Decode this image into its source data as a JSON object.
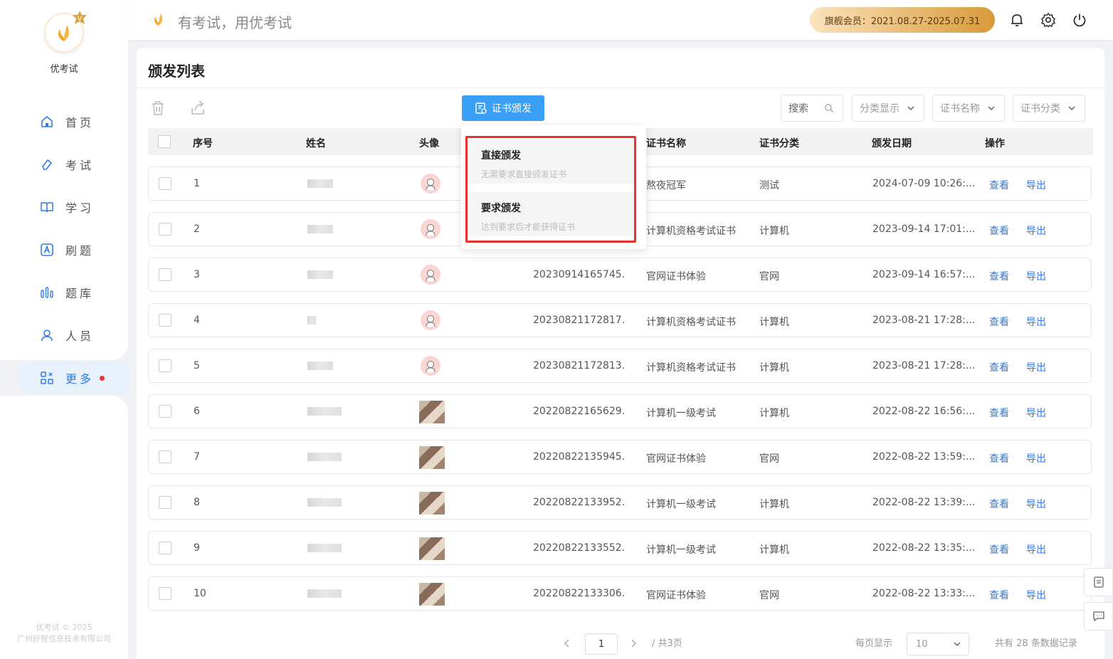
{
  "sidebar": {
    "brand": "优考试",
    "items": [
      {
        "label": "首页",
        "icon": "home-icon"
      },
      {
        "label": "考试",
        "icon": "eraser-icon"
      },
      {
        "label": "学习",
        "icon": "book-icon"
      },
      {
        "label": "刷题",
        "icon": "letter-a-icon"
      },
      {
        "label": "题库",
        "icon": "bars-icon"
      },
      {
        "label": "人员",
        "icon": "user-icon"
      },
      {
        "label": "更多",
        "icon": "apps-icon"
      }
    ],
    "copyright_1": "优考试 © 2025",
    "copyright_2": "广州好智信息技术有限公司"
  },
  "header": {
    "slogan": "有考试，用优考试",
    "vip": "旗舰会员：2021.08.27-2025.07.31"
  },
  "page": {
    "title": "颁发列表",
    "issue_button": "证书颁发",
    "search": "搜索",
    "filter_category": "分类显示",
    "filter_cert_name": "证书名称",
    "filter_cert_type": "证书分类"
  },
  "columns": {
    "index": "序号",
    "name": "姓名",
    "avatar": "头像",
    "cert_name": "证书名称",
    "cert_type": "证书分类",
    "date": "颁发日期",
    "ops": "操作"
  },
  "rows": [
    {
      "no": "1",
      "code": "",
      "cert": "熬夜冠军",
      "type": "测试",
      "date": "2024-07-09 10:26:...",
      "avatar": "default"
    },
    {
      "no": "2",
      "code": "",
      "cert": "计算机资格考试证书",
      "type": "计算机",
      "date": "2023-09-14 17:01:...",
      "avatar": "default"
    },
    {
      "no": "3",
      "code": "20230914165745...",
      "cert": "官网证书体验",
      "type": "官网",
      "date": "2023-09-14 16:57:...",
      "avatar": "default"
    },
    {
      "no": "4",
      "code": "20230821172817...",
      "cert": "计算机资格考试证书",
      "type": "计算机",
      "date": "2023-08-21 17:28:...",
      "avatar": "default"
    },
    {
      "no": "5",
      "code": "20230821172813...",
      "cert": "计算机资格考试证书",
      "type": "计算机",
      "date": "2023-08-21 17:28:...",
      "avatar": "default"
    },
    {
      "no": "6",
      "code": "20220822165629...",
      "cert": "计算机一级考试",
      "type": "计算机",
      "date": "2022-08-22 16:56:...",
      "avatar": "photo"
    },
    {
      "no": "7",
      "code": "20220822135945...",
      "cert": "官网证书体验",
      "type": "官网",
      "date": "2022-08-22 13:59:...",
      "avatar": "photo"
    },
    {
      "no": "8",
      "code": "20220822133952...",
      "cert": "计算机一级考试",
      "type": "计算机",
      "date": "2022-08-22 13:39:...",
      "avatar": "photo"
    },
    {
      "no": "9",
      "code": "20220822133552...",
      "cert": "计算机一级考试",
      "type": "计算机",
      "date": "2022-08-22 13:35:...",
      "avatar": "photo"
    },
    {
      "no": "10",
      "code": "20220822133306...",
      "cert": "官网证书体验",
      "type": "官网",
      "date": "2022-08-22 13:33:...",
      "avatar": "photo"
    }
  ],
  "row_actions": {
    "view": "查看",
    "export": "导出"
  },
  "dropdown": {
    "direct_title": "直接颁发",
    "direct_desc": "无需要求直接颁发证书",
    "require_title": "要求颁发",
    "require_desc": "达到要求后才能获得证书"
  },
  "pager": {
    "current": "1",
    "total_pages": "/ 共3页",
    "per_page_label": "每页显示",
    "per_page": "10",
    "total": "共有 28 条数据记录"
  },
  "colors": {
    "accent": "#2f7be6",
    "button": "#3aa0f5",
    "highlight": "#e5322d"
  }
}
